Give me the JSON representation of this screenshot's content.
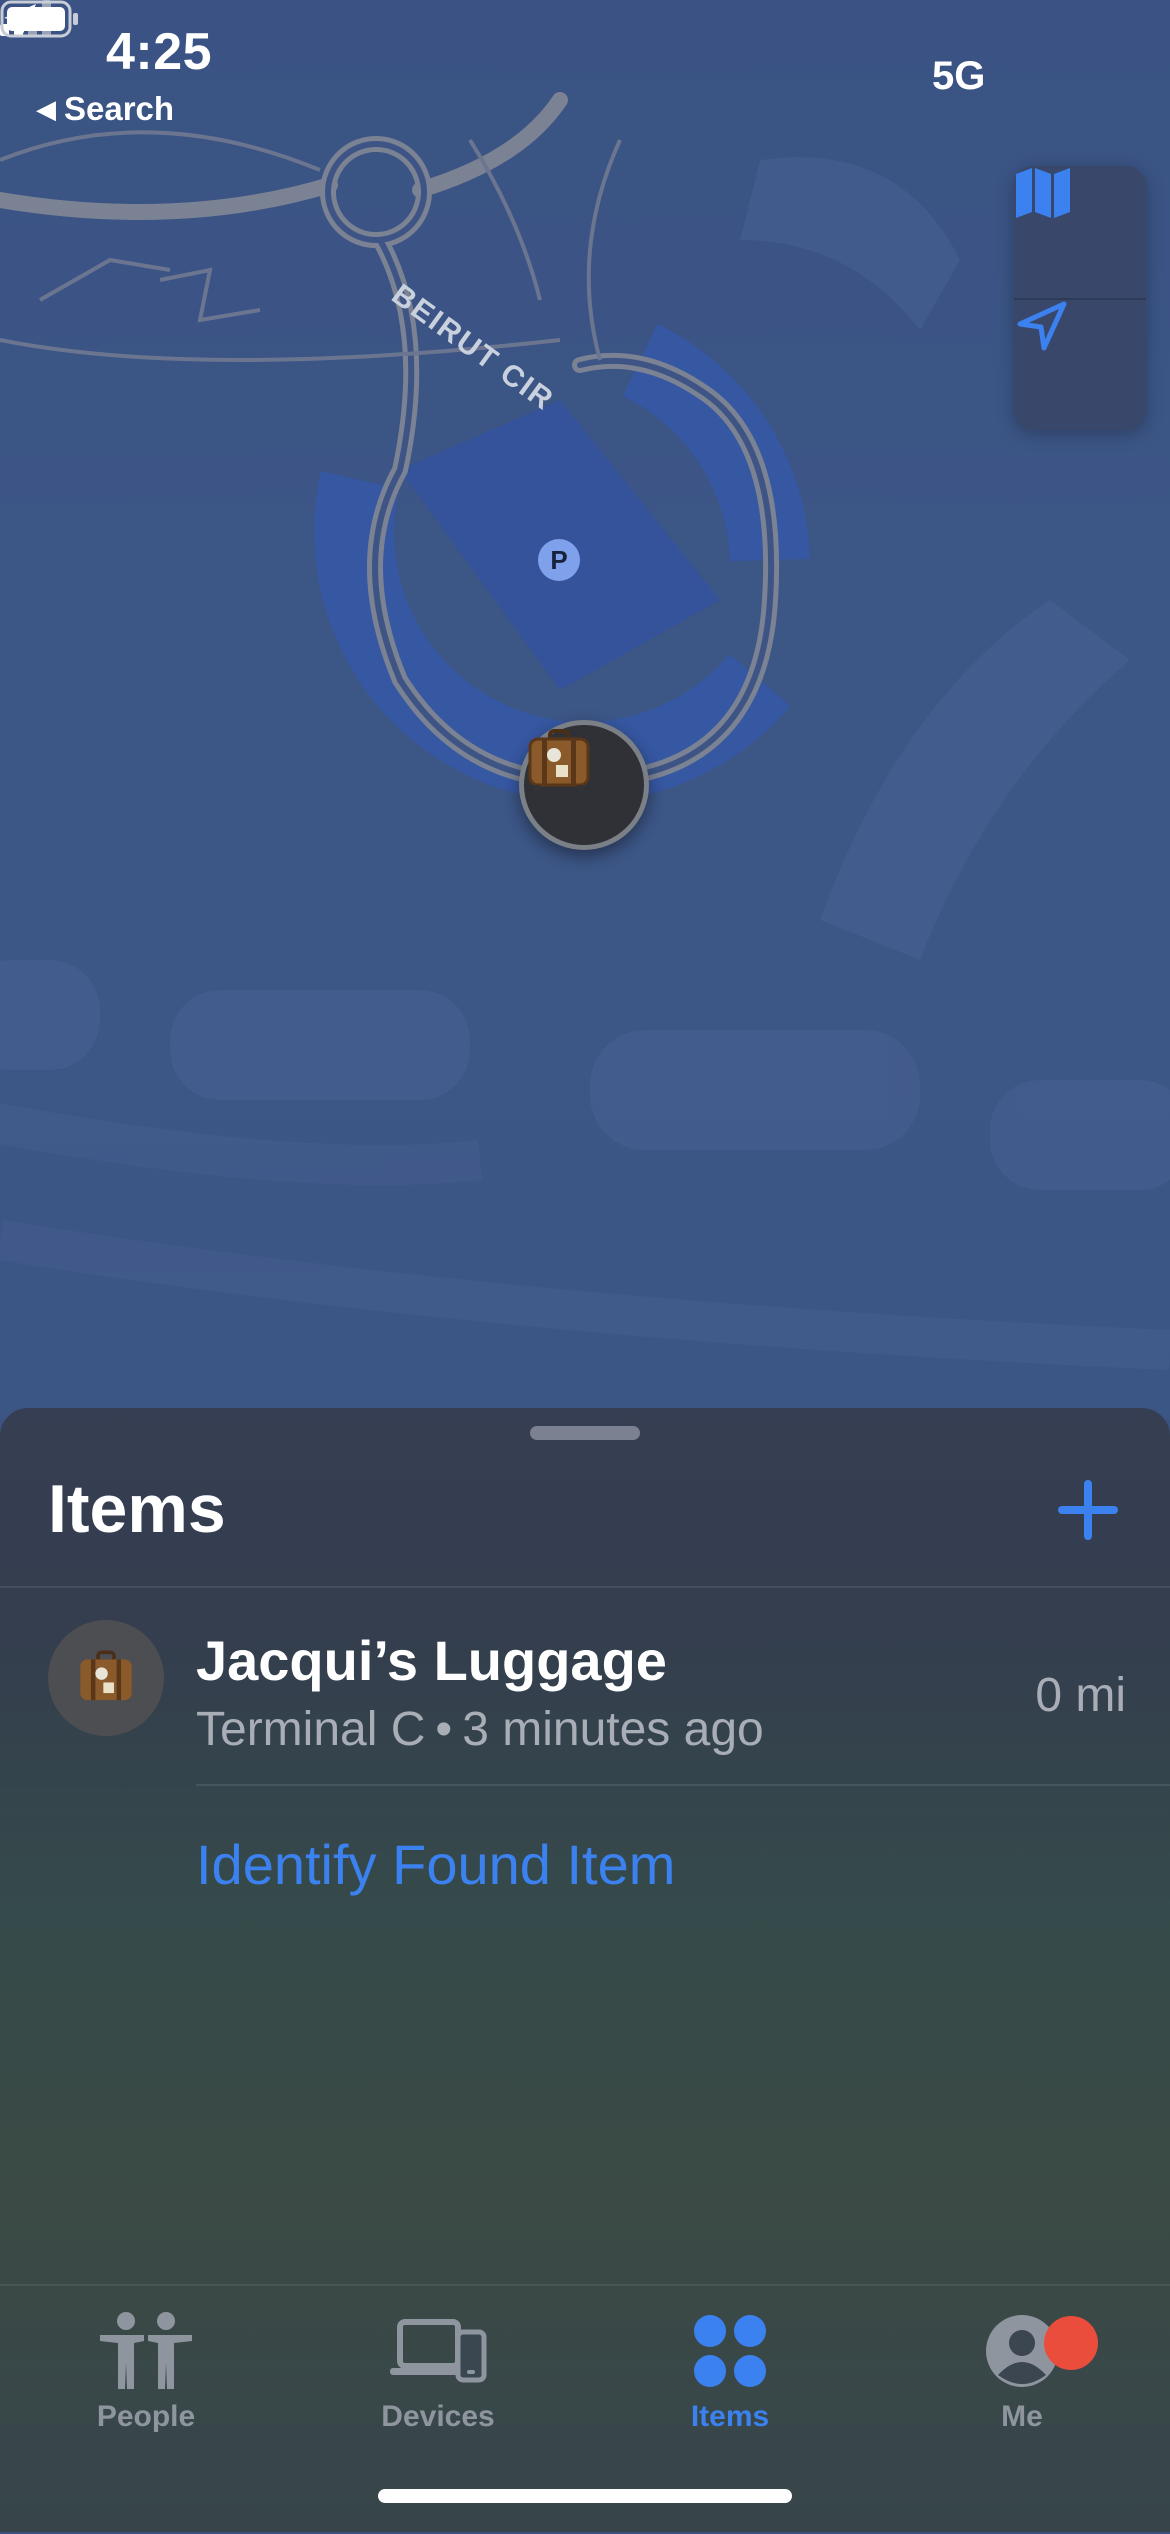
{
  "status_bar": {
    "time": "4:25",
    "back_label": "Search",
    "network": "5G"
  },
  "map": {
    "road_label": "BEIRUT CIR",
    "parking_marker": "P",
    "item_pin_icon": "luggage-icon",
    "controls": [
      "map-mode-icon",
      "location-arrow-icon"
    ]
  },
  "sheet": {
    "title": "Items",
    "add_icon": "plus-icon",
    "items": [
      {
        "name": "Jacqui’s Luggage",
        "location": "Terminal C",
        "separator": "•",
        "time_ago": "3 minutes ago",
        "distance": "0 mi",
        "icon": "luggage-icon"
      }
    ],
    "identify_link": "Identify Found Item"
  },
  "tabbar": {
    "tabs": [
      {
        "label": "People",
        "icon": "people-icon",
        "active": false
      },
      {
        "label": "Devices",
        "icon": "devices-icon",
        "active": false
      },
      {
        "label": "Items",
        "icon": "items-icon",
        "active": true
      },
      {
        "label": "Me",
        "icon": "me-icon",
        "active": false,
        "badge": true
      }
    ]
  },
  "colors": {
    "accent": "#3b82f0",
    "badge": "#eb4d3d",
    "map_bg": "#3b5585"
  }
}
